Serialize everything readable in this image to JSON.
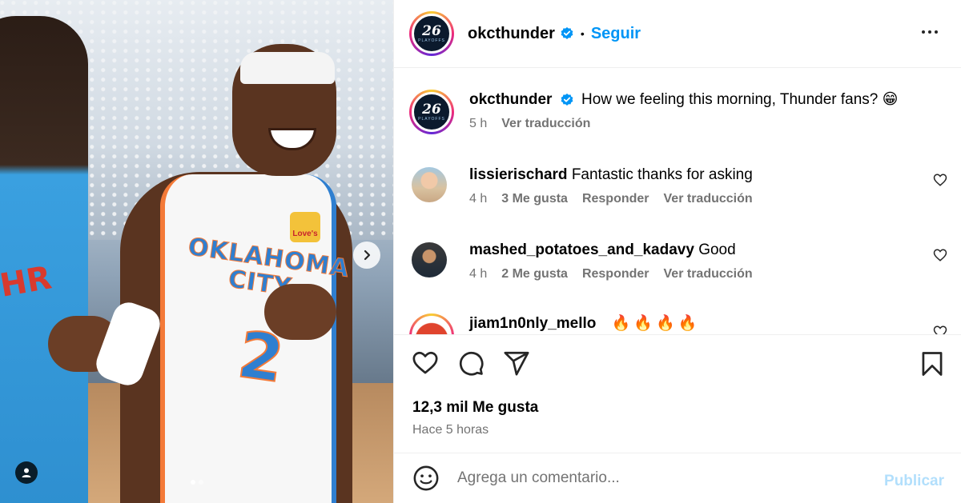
{
  "post": {
    "author": "okcthunder",
    "follow_label": "Seguir",
    "separator": "•",
    "avatar_number": "26",
    "avatar_sub": "PLAYOFFS",
    "caption": "How we feeling this morning, Thunder fans? 😁",
    "caption_time": "5 h",
    "translate_label": "Ver traducción"
  },
  "photo": {
    "jersey_text": "OKLAHOMA CITY",
    "jersey_number": "2",
    "patch_text": "Love's",
    "teammate_text": "HR"
  },
  "comments": [
    {
      "username": "lissierischard",
      "text": "Fantastic thanks for asking",
      "time": "4 h",
      "likes": "3 Me gusta",
      "reply_label": "Responder",
      "translate_label": "Ver traducción"
    },
    {
      "username": "mashed_potatoes_and_kadavy",
      "text": "Good",
      "time": "4 h",
      "likes": "2 Me gusta",
      "reply_label": "Responder",
      "translate_label": "Ver traducción"
    },
    {
      "username": "jiam1n0nly_mello",
      "text": "🔥🔥🔥🔥"
    }
  ],
  "engagement": {
    "likes": "12,3 mil Me gusta",
    "posted": "Hace 5 horas"
  },
  "composer": {
    "placeholder": "Agrega un comentario...",
    "publish_label": "Publicar"
  },
  "colors": {
    "accent": "#0095f6",
    "publish_disabled": "#b2dffc",
    "muted": "#737373"
  }
}
